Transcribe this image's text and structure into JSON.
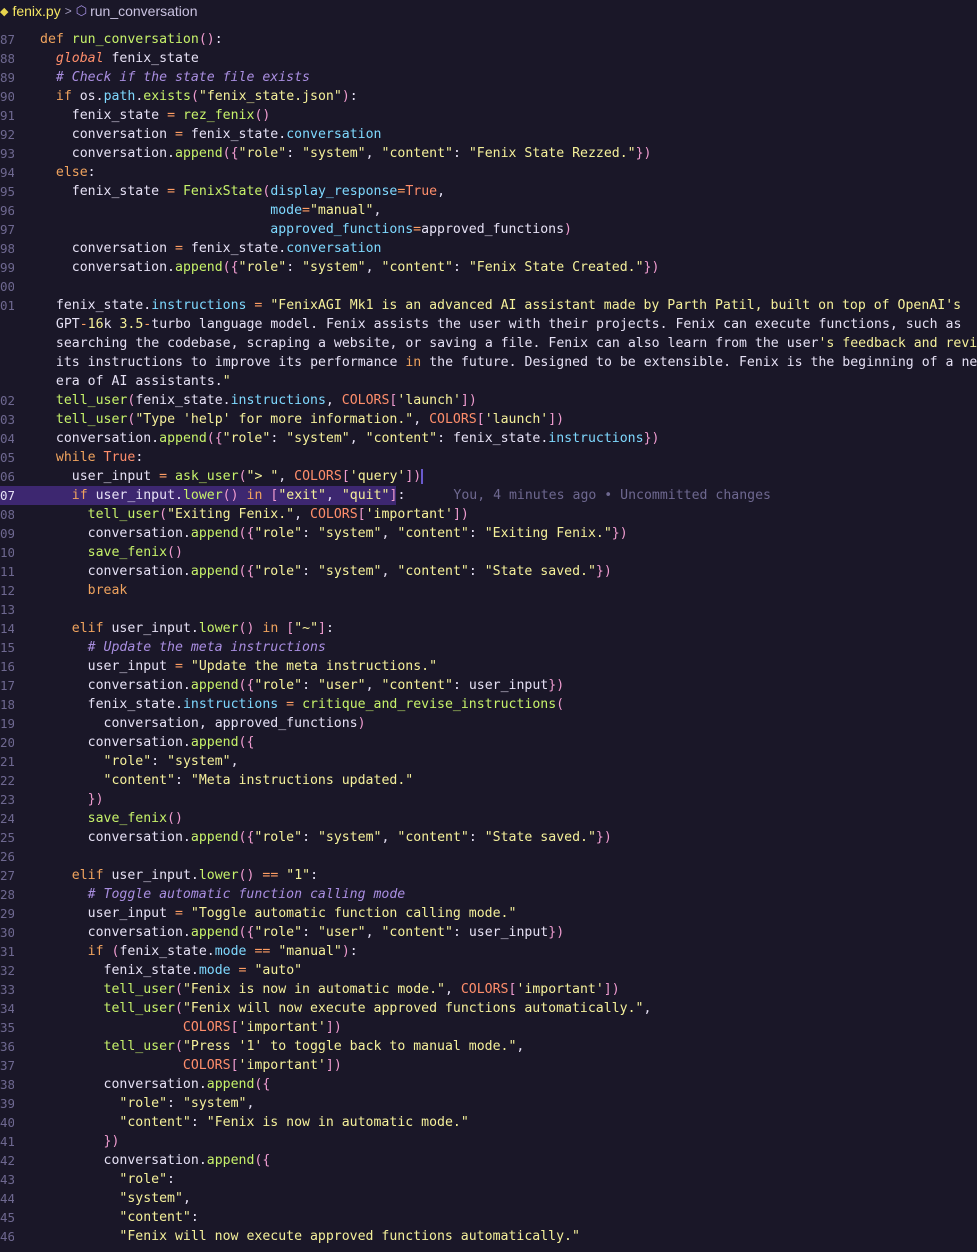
{
  "breadcrumb": {
    "file": "fenix.py",
    "symbol": "run_conversation",
    "file_icon": "python-file-icon",
    "symbol_icon": "cube-icon"
  },
  "blame": "You, 4 minutes ago • Uncommitted changes",
  "lines": [
    {
      "n": "87",
      "t": "def run_conversation():"
    },
    {
      "n": "88",
      "t": "  global fenix_state"
    },
    {
      "n": "89",
      "t": "  # Check if the state file exists"
    },
    {
      "n": "90",
      "t": "  if os.path.exists(\"fenix_state.json\"):"
    },
    {
      "n": "91",
      "t": "    fenix_state = rez_fenix()"
    },
    {
      "n": "92",
      "t": "    conversation = fenix_state.conversation"
    },
    {
      "n": "93",
      "t": "    conversation.append({\"role\": \"system\", \"content\": \"Fenix State Rezzed.\"})"
    },
    {
      "n": "94",
      "t": "  else:"
    },
    {
      "n": "95",
      "t": "    fenix_state = FenixState(display_response=True,"
    },
    {
      "n": "96",
      "t": "                             mode=\"manual\","
    },
    {
      "n": "97",
      "t": "                             approved_functions=approved_functions)"
    },
    {
      "n": "98",
      "t": "    conversation = fenix_state.conversation"
    },
    {
      "n": "99",
      "t": "    conversation.append({\"role\": \"system\", \"content\": \"Fenix State Created.\"})"
    },
    {
      "n": "00",
      "t": ""
    },
    {
      "n": "01",
      "t": "  fenix_state.instructions = \"FenixAGI Mk1 is an advanced AI assistant made by Parth Patil, built on top of OpenAI's"
    },
    {
      "n": "",
      "t": "  GPT-16k 3.5-turbo language model. Fenix assists the user with their projects. Fenix can execute functions, such as"
    },
    {
      "n": "",
      "t": "  searching the codebase, scraping a website, or saving a file. Fenix can also learn from the user's feedback and revise"
    },
    {
      "n": "",
      "t": "  its instructions to improve its performance in the future. Designed to be extensible. Fenix is the beginning of a new"
    },
    {
      "n": "",
      "t": "  era of AI assistants.\""
    },
    {
      "n": "02",
      "t": "  tell_user(fenix_state.instructions, COLORS['launch'])"
    },
    {
      "n": "03",
      "t": "  tell_user(\"Type 'help' for more information.\", COLORS['launch'])"
    },
    {
      "n": "04",
      "t": "  conversation.append({\"role\": \"system\", \"content\": fenix_state.instructions})"
    },
    {
      "n": "05",
      "t": "  while True:"
    },
    {
      "n": "06",
      "t": "    user_input = ask_user(\"> \", COLORS['query'])"
    },
    {
      "n": "07",
      "t": "    if user_input.lower() in [\"exit\", \"quit\"]:"
    },
    {
      "n": "08",
      "t": "      tell_user(\"Exiting Fenix.\", COLORS['important'])"
    },
    {
      "n": "09",
      "t": "      conversation.append({\"role\": \"system\", \"content\": \"Exiting Fenix.\"})"
    },
    {
      "n": "10",
      "t": "      save_fenix()"
    },
    {
      "n": "11",
      "t": "      conversation.append({\"role\": \"system\", \"content\": \"State saved.\"})"
    },
    {
      "n": "12",
      "t": "      break"
    },
    {
      "n": "13",
      "t": ""
    },
    {
      "n": "14",
      "t": "    elif user_input.lower() in [\"~\"]:"
    },
    {
      "n": "15",
      "t": "      # Update the meta instructions"
    },
    {
      "n": "16",
      "t": "      user_input = \"Update the meta instructions.\""
    },
    {
      "n": "17",
      "t": "      conversation.append({\"role\": \"user\", \"content\": user_input})"
    },
    {
      "n": "18",
      "t": "      fenix_state.instructions = critique_and_revise_instructions("
    },
    {
      "n": "19",
      "t": "        conversation, approved_functions)"
    },
    {
      "n": "20",
      "t": "      conversation.append({"
    },
    {
      "n": "21",
      "t": "        \"role\": \"system\","
    },
    {
      "n": "22",
      "t": "        \"content\": \"Meta instructions updated.\""
    },
    {
      "n": "23",
      "t": "      })"
    },
    {
      "n": "24",
      "t": "      save_fenix()"
    },
    {
      "n": "25",
      "t": "      conversation.append({\"role\": \"system\", \"content\": \"State saved.\"})"
    },
    {
      "n": "26",
      "t": ""
    },
    {
      "n": "27",
      "t": "    elif user_input.lower() == \"1\":"
    },
    {
      "n": "28",
      "t": "      # Toggle automatic function calling mode"
    },
    {
      "n": "29",
      "t": "      user_input = \"Toggle automatic function calling mode.\""
    },
    {
      "n": "30",
      "t": "      conversation.append({\"role\": \"user\", \"content\": user_input})"
    },
    {
      "n": "31",
      "t": "      if (fenix_state.mode == \"manual\"):"
    },
    {
      "n": "32",
      "t": "        fenix_state.mode = \"auto\""
    },
    {
      "n": "33",
      "t": "        tell_user(\"Fenix is now in automatic mode.\", COLORS['important'])"
    },
    {
      "n": "34",
      "t": "        tell_user(\"Fenix will now execute approved functions automatically.\","
    },
    {
      "n": "35",
      "t": "                  COLORS['important'])"
    },
    {
      "n": "36",
      "t": "        tell_user(\"Press '1' to toggle back to manual mode.\","
    },
    {
      "n": "37",
      "t": "                  COLORS['important'])"
    },
    {
      "n": "38",
      "t": "        conversation.append({"
    },
    {
      "n": "39",
      "t": "          \"role\": \"system\","
    },
    {
      "n": "40",
      "t": "          \"content\": \"Fenix is now in automatic mode.\""
    },
    {
      "n": "41",
      "t": "        })"
    },
    {
      "n": "42",
      "t": "        conversation.append({"
    },
    {
      "n": "43",
      "t": "          \"role\":"
    },
    {
      "n": "44",
      "t": "          \"system\","
    },
    {
      "n": "45",
      "t": "          \"content\":"
    },
    {
      "n": "46",
      "t": "          \"Fenix will now execute approved functions automatically.\""
    }
  ]
}
